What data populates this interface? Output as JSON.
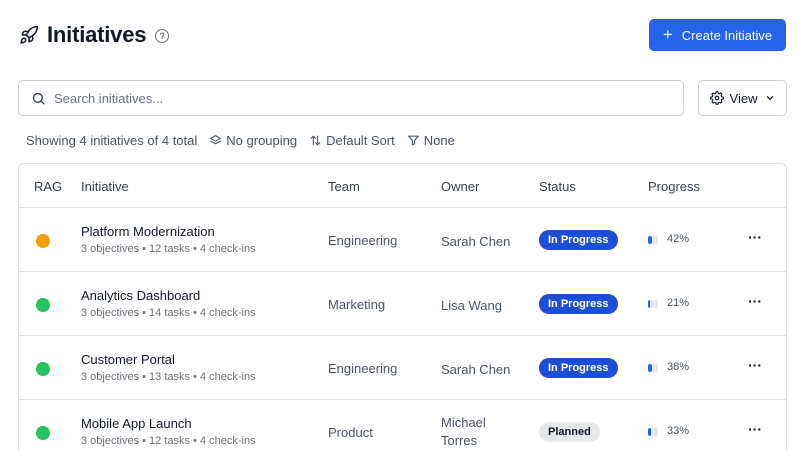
{
  "header": {
    "title": "Initiatives",
    "create_label": "Create Initiative"
  },
  "search": {
    "placeholder": "Search initiatives..."
  },
  "view": {
    "label": "View"
  },
  "meta": {
    "summary": "Showing 4 initiatives of 4 total",
    "grouping": "No grouping",
    "sort": "Default Sort",
    "filter": "None"
  },
  "table": {
    "headers": {
      "rag": "RAG",
      "initiative": "Initiative",
      "team": "Team",
      "owner": "Owner",
      "status": "Status",
      "progress": "Progress"
    },
    "rows": [
      {
        "rag_color": "#f59e0b",
        "name": "Platform Modernization",
        "detail": "3 objectives • 12 tasks • 4 check-ins",
        "team": "Engineering",
        "owner_line1": "Sarah Chen",
        "owner_line2": "",
        "status": "In Progress",
        "status_style": "blue",
        "progress": 42,
        "progress_label": "42%"
      },
      {
        "rag_color": "#22c55e",
        "name": "Analytics Dashboard",
        "detail": "3 objectives • 14 tasks • 4 check-ins",
        "team": "Marketing",
        "owner_line1": "Lisa Wang",
        "owner_line2": "",
        "status": "In Progress",
        "status_style": "blue",
        "progress": 21,
        "progress_label": "21%"
      },
      {
        "rag_color": "#22c55e",
        "name": "Customer Portal",
        "detail": "3 objectives • 13 tasks • 4 check-ins",
        "team": "Engineering",
        "owner_line1": "Sarah Chen",
        "owner_line2": "",
        "status": "In Progress",
        "status_style": "blue",
        "progress": 38,
        "progress_label": "38%"
      },
      {
        "rag_color": "#22c55e",
        "name": "Mobile App Launch",
        "detail": "3 objectives • 12 tasks • 4 check-ins",
        "team": "Product",
        "owner_line1": "Michael",
        "owner_line2": "Torres",
        "status": "Planned",
        "status_style": "gray",
        "progress": 33,
        "progress_label": "33%"
      }
    ]
  },
  "icons": {
    "title": "rocket-icon",
    "help": "help-circle-icon",
    "create": "plus-icon",
    "search": "search-icon",
    "view": "gear-icon",
    "view_caret": "chevron-down-icon",
    "grouping": "layers-icon",
    "sort": "sort-arrows-icon",
    "filter": "filter-icon",
    "row_menu": "more-horizontal-icon"
  },
  "colors": {
    "primary": "#2563eb",
    "in_progress_badge": "#1d4ed8",
    "planned_badge": "#e5e7eb",
    "rag_amber": "#f59e0b",
    "rag_green": "#22c55e"
  }
}
